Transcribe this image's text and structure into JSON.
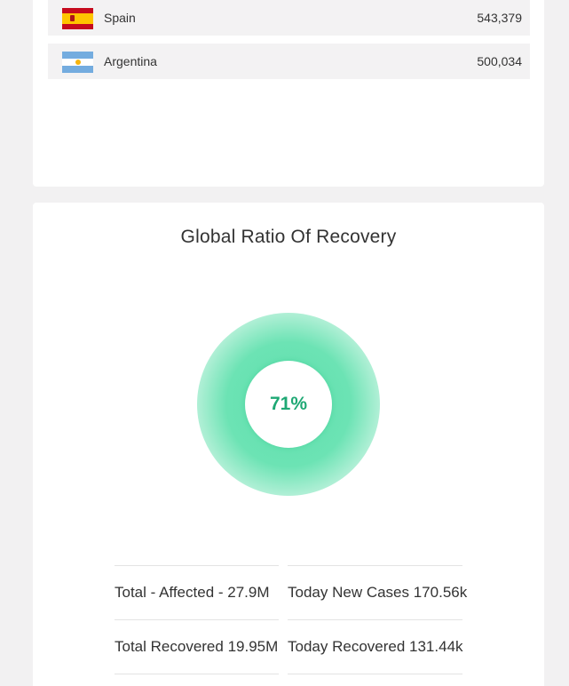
{
  "countries": [
    {
      "name": "Spain",
      "value": "543,379",
      "flag": "spain-flag"
    },
    {
      "name": "Argentina",
      "value": "500,034",
      "flag": "argentina-flag"
    }
  ],
  "recovery": {
    "title": "Global Ratio Of Recovery",
    "ratio_label": "71%",
    "ratio_value": 71,
    "accent_color": "#1ea874"
  },
  "stats": {
    "total_affected": "Total - Affected - 27.9M",
    "today_new_cases": "Today New Cases 170.56k",
    "total_recovered": "Total Recovered 19.95M",
    "today_recovered": "Today Recovered 131.44k"
  }
}
